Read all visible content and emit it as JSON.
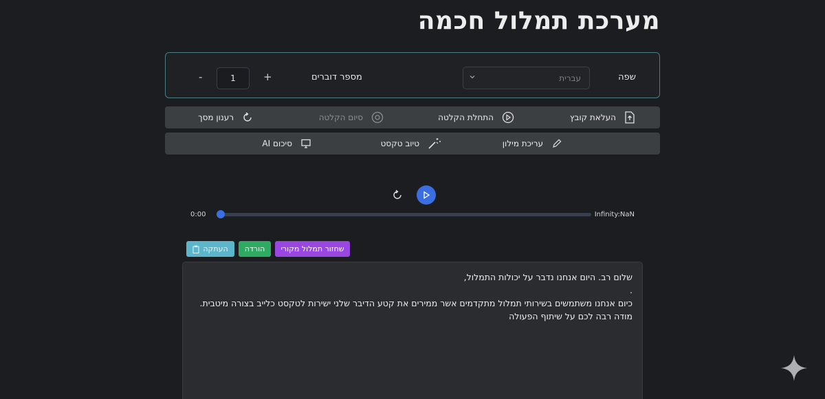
{
  "header": {
    "title": "מערכת תמלול חכמה"
  },
  "settings": {
    "language_label": "שפה",
    "language_value": "עברית",
    "speakers_label": "מספר דוברים",
    "speakers_value": "1",
    "plus_label": "+",
    "minus_label": "-"
  },
  "toolbar1": {
    "upload": "העלאת קובץ",
    "start_recording": "התחלת הקלטה",
    "end_recording": "סיום הקלטה",
    "refresh": "רענון מסך"
  },
  "toolbar2": {
    "dictionary": "עריכת מילון",
    "improve_text": "טיוב טקסט",
    "ai_summary": "סיכום AI"
  },
  "player": {
    "time_start": "0:00",
    "time_end": "Infinity:NaN",
    "progress": 0
  },
  "actions": {
    "copy": "העתקה",
    "download": "הורדה",
    "restore": "שחזור תמלול מקורי"
  },
  "transcript": {
    "lines": [
      "שלום רב. היום אנחנו נדבר על יכולות התמלול,",
      ".",
      "כיום אנחנו משתמשים בשירותי תמלול מתקדמים אשר ממירים את קטע הדיבר שלני ישירות לטקסט כלייב בצורה מיטבית.",
      "מודה רבה לכם על שיתוף הפעולה"
    ]
  },
  "colors": {
    "background": "#1c1d20",
    "accent_blue": "#3b6ee0",
    "copy_button": "#5bb6cc",
    "download_button": "#2eaa62",
    "restore_button": "#9a46e0",
    "settings_border": "#4a7f86"
  },
  "icons": {
    "upload": "file-upload-icon",
    "start_recording": "play-circle-icon",
    "end_recording": "stop-circle-icon",
    "refresh": "refresh-icon",
    "dictionary": "pencil-icon",
    "improve_text": "magic-wand-icon",
    "ai_summary": "monitor-icon",
    "copy": "clipboard-icon",
    "sparkle": "sparkle-icon"
  }
}
